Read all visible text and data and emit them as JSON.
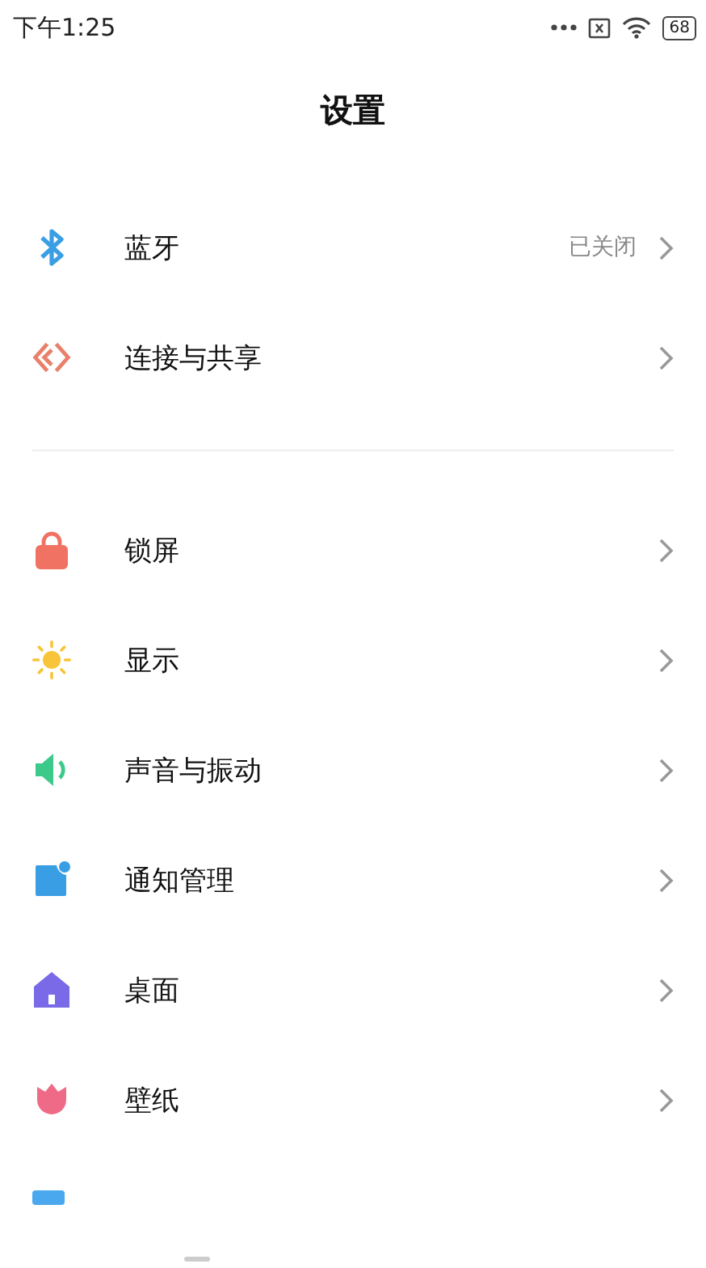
{
  "status_bar": {
    "time": "下午1:25",
    "battery": "68"
  },
  "title": "设置",
  "sections": [
    {
      "items": [
        {
          "kind": "row",
          "label": "蓝牙",
          "value": "已关闭"
        },
        {
          "kind": "row",
          "label": "连接与共享"
        }
      ]
    },
    {
      "items": [
        {
          "kind": "row",
          "label": "锁屏"
        },
        {
          "kind": "row",
          "label": "显示"
        },
        {
          "kind": "row",
          "label": "声音与振动"
        },
        {
          "kind": "row",
          "label": "通知管理"
        },
        {
          "kind": "row",
          "label": "桌面"
        },
        {
          "kind": "row",
          "label": "壁纸"
        },
        {
          "kind": "partial"
        }
      ]
    }
  ]
}
